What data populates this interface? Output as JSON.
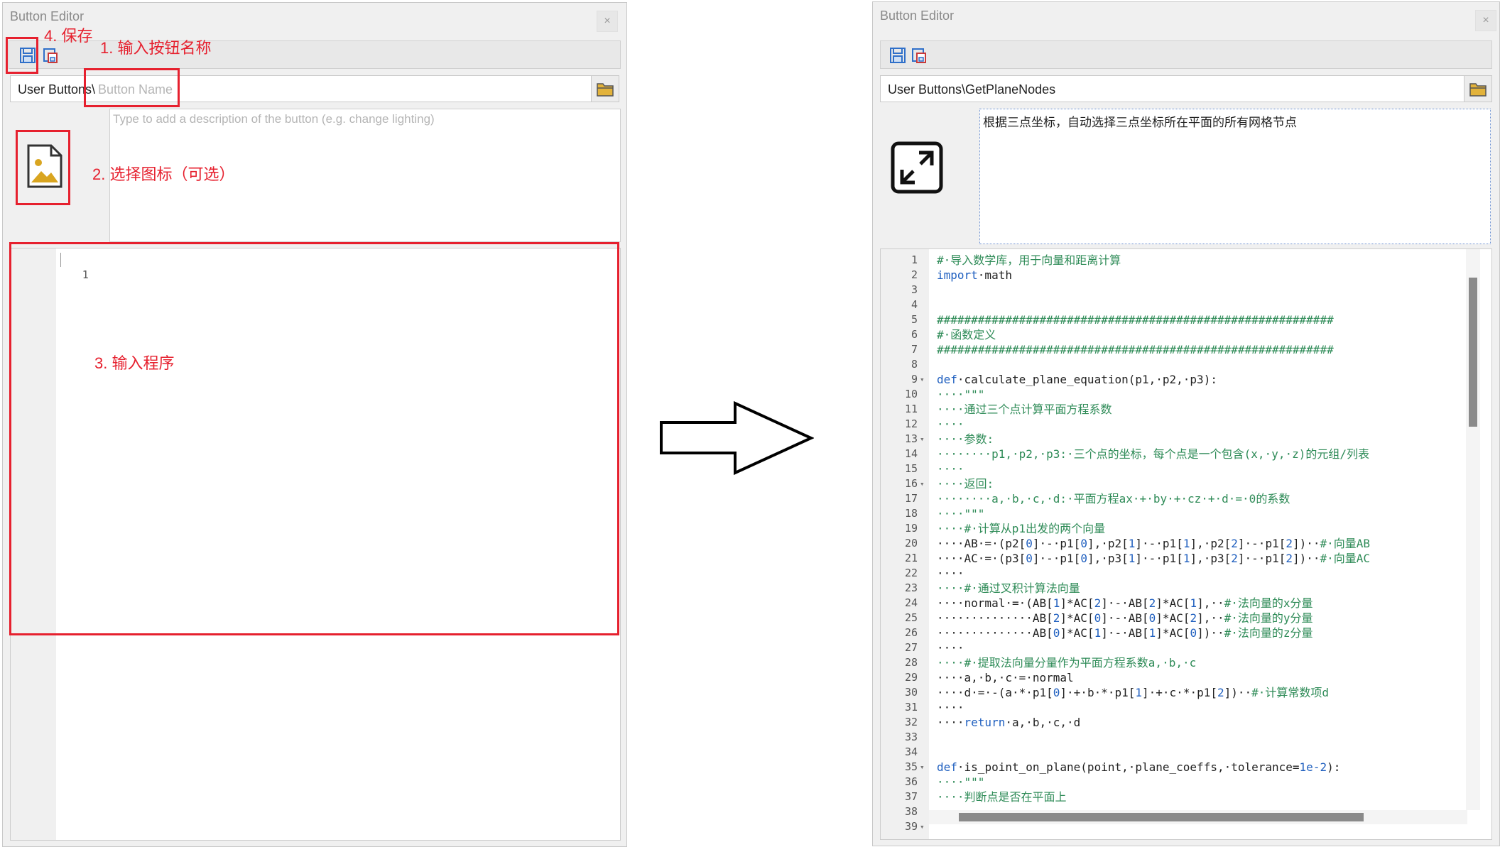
{
  "left_window": {
    "title": "Button Editor",
    "close_label": "×",
    "path_prefix": "User Buttons\\",
    "name_placeholder": "Button Name",
    "description_placeholder": "Type to add a description of the button (e.g. change lighting)",
    "line_numbers": [
      "1"
    ]
  },
  "annotations": {
    "save": "4. 保存",
    "name": "1. 输入按钮名称",
    "icon": "2. 选择图标（可选）",
    "program": "3. 输入程序"
  },
  "right_window": {
    "title": "Button Editor",
    "close_label": "×",
    "path": "User Buttons\\GetPlaneNodes",
    "description": "根据三点坐标，自动选择三点坐标所在平面的所有网格节点",
    "icon": "expand-arrows-icon",
    "code_lines": [
      {
        "n": "1",
        "fold": "",
        "t": "#·导入数学库，用于向量和距离计算",
        "cls": "c-comment"
      },
      {
        "n": "2",
        "fold": "",
        "t": "import·math",
        "cls": ""
      },
      {
        "n": "3",
        "fold": "",
        "t": "",
        "cls": ""
      },
      {
        "n": "4",
        "fold": "",
        "t": "",
        "cls": ""
      },
      {
        "n": "5",
        "fold": "",
        "t": "##########################################################",
        "cls": "c-comment"
      },
      {
        "n": "6",
        "fold": "",
        "t": "#·函数定义",
        "cls": "c-comment"
      },
      {
        "n": "7",
        "fold": "",
        "t": "##########################################################",
        "cls": "c-comment"
      },
      {
        "n": "8",
        "fold": "",
        "t": "",
        "cls": ""
      },
      {
        "n": "9",
        "fold": "▾",
        "t": "def·calculate_plane_equation(p1,·p2,·p3):",
        "cls": ""
      },
      {
        "n": "10",
        "fold": "",
        "t": "····\"\"\"",
        "cls": "c-str"
      },
      {
        "n": "11",
        "fold": "",
        "t": "····通过三个点计算平面方程系数",
        "cls": "c-str"
      },
      {
        "n": "12",
        "fold": "",
        "t": "····",
        "cls": "c-str"
      },
      {
        "n": "13",
        "fold": "▾",
        "t": "····参数:",
        "cls": "c-str"
      },
      {
        "n": "14",
        "fold": "",
        "t": "········p1,·p2,·p3:·三个点的坐标，每个点是一个包含(x,·y,·z)的元组/列表",
        "cls": "c-str"
      },
      {
        "n": "15",
        "fold": "",
        "t": "····",
        "cls": "c-str"
      },
      {
        "n": "16",
        "fold": "▾",
        "t": "····返回:",
        "cls": "c-str"
      },
      {
        "n": "17",
        "fold": "",
        "t": "········a,·b,·c,·d:·平面方程ax·+·by·+·cz·+·d·=·0的系数",
        "cls": "c-str"
      },
      {
        "n": "18",
        "fold": "",
        "t": "····\"\"\"",
        "cls": "c-str"
      },
      {
        "n": "19",
        "fold": "",
        "t": "····#·计算从p1出发的两个向量",
        "cls": "c-comment"
      },
      {
        "n": "20",
        "fold": "",
        "t": "····AB·=·(p2[0]·-·p1[0],·p2[1]·-·p1[1],·p2[2]·-·p1[2])··#·向量AB",
        "cls": ""
      },
      {
        "n": "21",
        "fold": "",
        "t": "····AC·=·(p3[0]·-·p1[0],·p3[1]·-·p1[1],·p3[2]·-·p1[2])··#·向量AC",
        "cls": ""
      },
      {
        "n": "22",
        "fold": "",
        "t": "····",
        "cls": ""
      },
      {
        "n": "23",
        "fold": "",
        "t": "····#·通过叉积计算法向量",
        "cls": "c-comment"
      },
      {
        "n": "24",
        "fold": "",
        "t": "····normal·=·(AB[1]*AC[2]·-·AB[2]*AC[1],··#·法向量的x分量",
        "cls": ""
      },
      {
        "n": "25",
        "fold": "",
        "t": "··············AB[2]*AC[0]·-·AB[0]*AC[2],··#·法向量的y分量",
        "cls": ""
      },
      {
        "n": "26",
        "fold": "",
        "t": "··············AB[0]*AC[1]·-·AB[1]*AC[0])··#·法向量的z分量",
        "cls": ""
      },
      {
        "n": "27",
        "fold": "",
        "t": "····",
        "cls": ""
      },
      {
        "n": "28",
        "fold": "",
        "t": "····#·提取法向量分量作为平面方程系数a,·b,·c",
        "cls": "c-comment"
      },
      {
        "n": "29",
        "fold": "",
        "t": "····a,·b,·c·=·normal",
        "cls": ""
      },
      {
        "n": "30",
        "fold": "",
        "t": "····d·=·-(a·*·p1[0]·+·b·*·p1[1]·+·c·*·p1[2])··#·计算常数项d",
        "cls": ""
      },
      {
        "n": "31",
        "fold": "",
        "t": "····",
        "cls": ""
      },
      {
        "n": "32",
        "fold": "",
        "t": "····return·a,·b,·c,·d",
        "cls": ""
      },
      {
        "n": "33",
        "fold": "",
        "t": "",
        "cls": ""
      },
      {
        "n": "34",
        "fold": "",
        "t": "",
        "cls": ""
      },
      {
        "n": "35",
        "fold": "▾",
        "t": "def·is_point_on_plane(point,·plane_coeffs,·tolerance=1e-2):",
        "cls": ""
      },
      {
        "n": "36",
        "fold": "",
        "t": "····\"\"\"",
        "cls": "c-str"
      },
      {
        "n": "37",
        "fold": "",
        "t": "····判断点是否在平面上",
        "cls": "c-str"
      },
      {
        "n": "38",
        "fold": "",
        "t": "",
        "cls": ""
      },
      {
        "n": "39",
        "fold": "▾",
        "t": "",
        "cls": ""
      }
    ]
  },
  "colors": {
    "annotation_red": "#e6202e",
    "comment_green": "#2e8b57",
    "keyword_blue": "#1f5fbf"
  }
}
